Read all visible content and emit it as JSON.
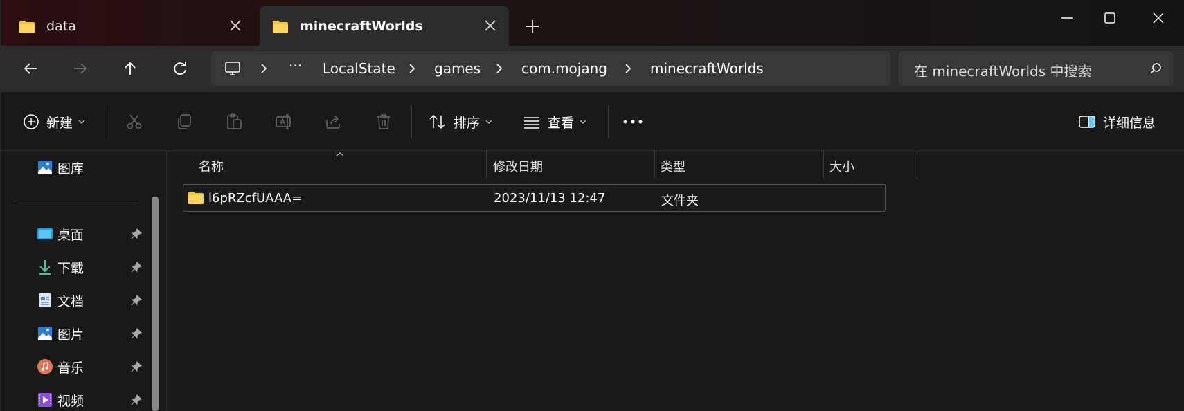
{
  "tabs": [
    {
      "label": "data",
      "icon": "folder-icon",
      "active": false
    },
    {
      "label": "minecraftWorlds",
      "icon": "folder-icon",
      "active": true
    }
  ],
  "breadcrumb": {
    "overflow": "···",
    "items": [
      "LocalState",
      "games",
      "com.mojang",
      "minecraftWorlds"
    ]
  },
  "search": {
    "placeholder": "在 minecraftWorlds 中搜索"
  },
  "toolbar": {
    "new_label": "新建",
    "sort_label": "排序",
    "view_label": "查看",
    "more_label": "···",
    "details_label": "详细信息"
  },
  "sidebar": {
    "items": [
      {
        "label": "图库",
        "icon": "gallery-icon",
        "pinned": false
      },
      {
        "label": "桌面",
        "icon": "desktop-icon",
        "pinned": true
      },
      {
        "label": "下载",
        "icon": "download-icon",
        "pinned": true
      },
      {
        "label": "文档",
        "icon": "documents-icon",
        "pinned": true
      },
      {
        "label": "图片",
        "icon": "pictures-icon",
        "pinned": true
      },
      {
        "label": "音乐",
        "icon": "music-icon",
        "pinned": true
      },
      {
        "label": "视频",
        "icon": "videos-icon",
        "pinned": true
      }
    ]
  },
  "columns": {
    "name": "名称",
    "modified": "修改日期",
    "type": "类型",
    "size": "大小"
  },
  "files": [
    {
      "name": "l6pRZcfUAAA=",
      "modified": "2023/11/13 12:47",
      "type": "文件夹",
      "size": ""
    }
  ],
  "colors": {
    "folder": "#f5c242",
    "accent": "#60cdff"
  }
}
